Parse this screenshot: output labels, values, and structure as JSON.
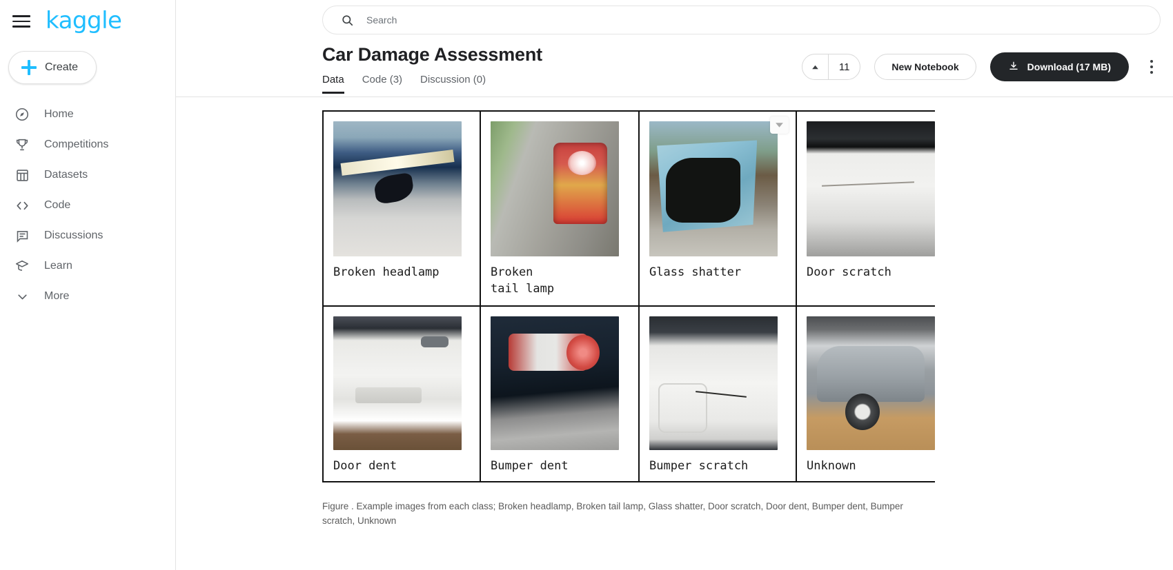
{
  "brand": {
    "name": "kaggle",
    "color": "#20beff"
  },
  "sidebar": {
    "create_label": "Create",
    "items": [
      {
        "label": "Home",
        "icon": "compass-icon"
      },
      {
        "label": "Competitions",
        "icon": "trophy-icon"
      },
      {
        "label": "Datasets",
        "icon": "table-icon"
      },
      {
        "label": "Code",
        "icon": "code-brackets-icon"
      },
      {
        "label": "Discussions",
        "icon": "comment-icon"
      },
      {
        "label": "Learn",
        "icon": "graduation-cap-icon"
      },
      {
        "label": "More",
        "icon": "chevron-down-icon"
      }
    ]
  },
  "search": {
    "placeholder": "Search",
    "value": ""
  },
  "header": {
    "title": "Car Damage Assessment",
    "tabs": [
      {
        "label": "Data",
        "active": true
      },
      {
        "label": "Code (3)",
        "active": false
      },
      {
        "label": "Discussion (0)",
        "active": false
      }
    ],
    "vote_count": "11",
    "new_notebook_label": "New Notebook",
    "download_label": "Download (17 MB)"
  },
  "figure": {
    "cells": [
      {
        "label": "Broken headlamp",
        "art": "p1"
      },
      {
        "label": "Broken\ntail lamp",
        "art": "p2"
      },
      {
        "label": "Glass shatter",
        "art": "p3"
      },
      {
        "label": "Door scratch",
        "art": "p4"
      },
      {
        "label": "Door dent",
        "art": "p5"
      },
      {
        "label": "Bumper dent",
        "art": "p6"
      },
      {
        "label": "Bumper scratch",
        "art": "p7"
      },
      {
        "label": "Unknown",
        "art": "p8"
      }
    ],
    "caption": "Figure . Example images from each class; Broken headlamp, Broken tail lamp, Glass shatter, Door scratch, Door dent, Bumper dent, Bumper scratch, Unknown"
  }
}
